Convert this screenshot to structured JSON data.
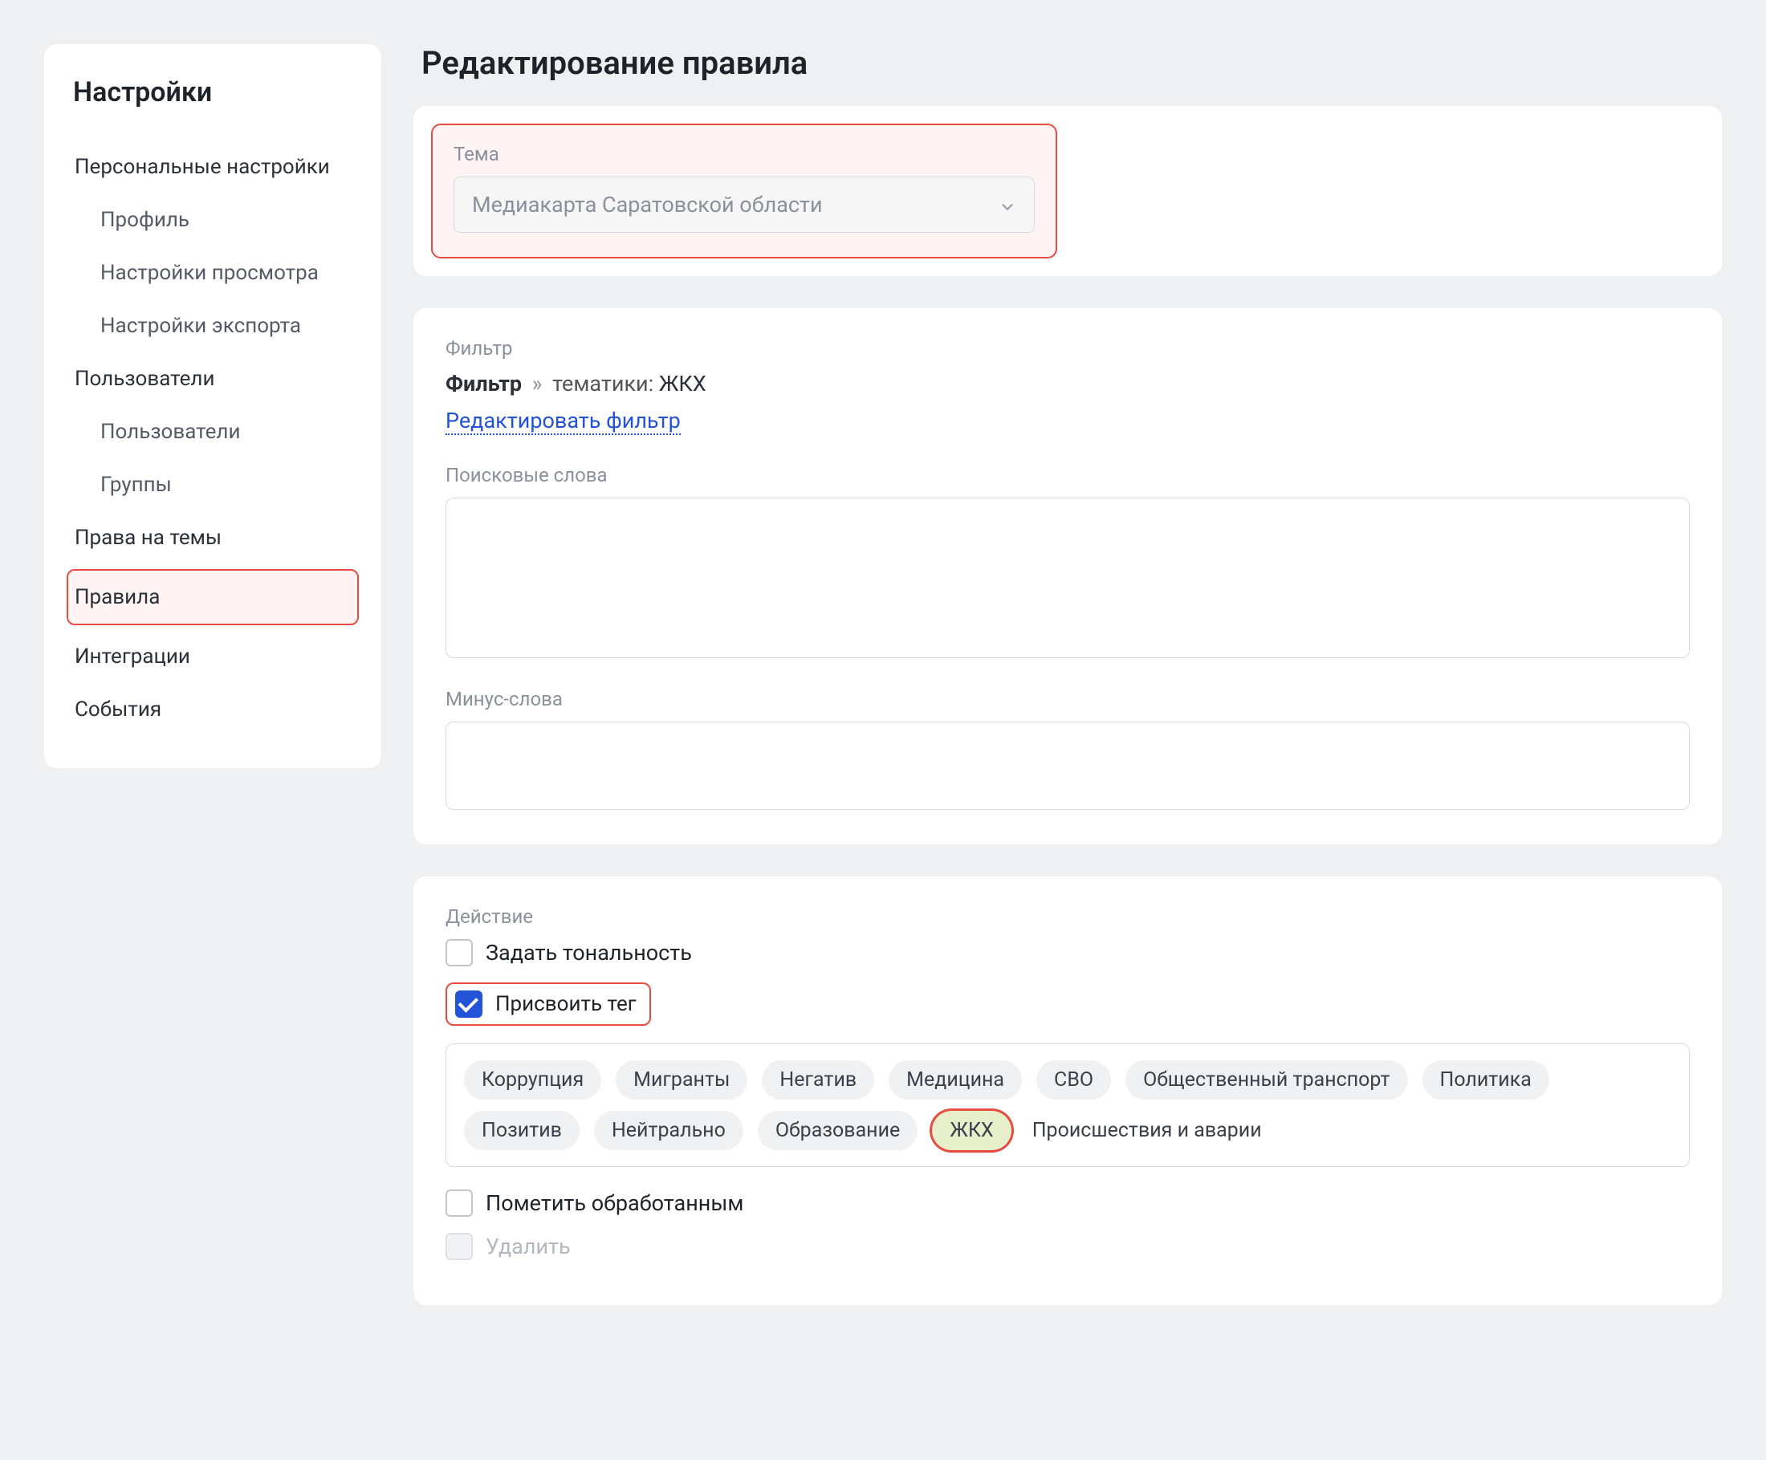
{
  "sidebar": {
    "title": "Настройки",
    "items": [
      {
        "label": "Персональные настройки",
        "sub": false
      },
      {
        "label": "Профиль",
        "sub": true
      },
      {
        "label": "Настройки просмотра",
        "sub": true
      },
      {
        "label": "Настройки экспорта",
        "sub": true
      },
      {
        "label": "Пользователи",
        "sub": false
      },
      {
        "label": "Пользователи",
        "sub": true
      },
      {
        "label": "Группы",
        "sub": true
      },
      {
        "label": "Права на темы",
        "sub": false
      },
      {
        "label": "Правила",
        "sub": false,
        "active": true
      },
      {
        "label": "Интеграции",
        "sub": false
      },
      {
        "label": "События",
        "sub": false
      }
    ]
  },
  "page": {
    "title": "Редактирование правила"
  },
  "theme": {
    "label": "Тема",
    "value": "Медиакарта Саратовской области"
  },
  "filter": {
    "label": "Фильтр",
    "bc_root": "Фильтр",
    "bc_sep": "»",
    "bc_key": "тематики:",
    "bc_val": "ЖКХ",
    "edit_link": "Редактировать фильтр",
    "search_label": "Поисковые слова",
    "minus_label": "Минус-слова"
  },
  "actions": {
    "label": "Действие",
    "tonality_label": "Задать тональность",
    "assign_tag_label": "Присвоить тег",
    "processed_label": "Пометить обработанным",
    "delete_label": "Удалить",
    "tonality_checked": false,
    "assign_tag_checked": true,
    "processed_checked": false
  },
  "tags": [
    {
      "label": "Коррупция"
    },
    {
      "label": "Мигранты"
    },
    {
      "label": "Негатив"
    },
    {
      "label": "Медицина"
    },
    {
      "label": "СВО"
    },
    {
      "label": "Общественный транспорт"
    },
    {
      "label": "Политика"
    },
    {
      "label": "Позитив"
    },
    {
      "label": "Нейтрально"
    },
    {
      "label": "Образование"
    },
    {
      "label": "ЖКХ",
      "selected": true,
      "ringed": true
    },
    {
      "label": "Происшествия и аварии",
      "plain": true
    }
  ]
}
